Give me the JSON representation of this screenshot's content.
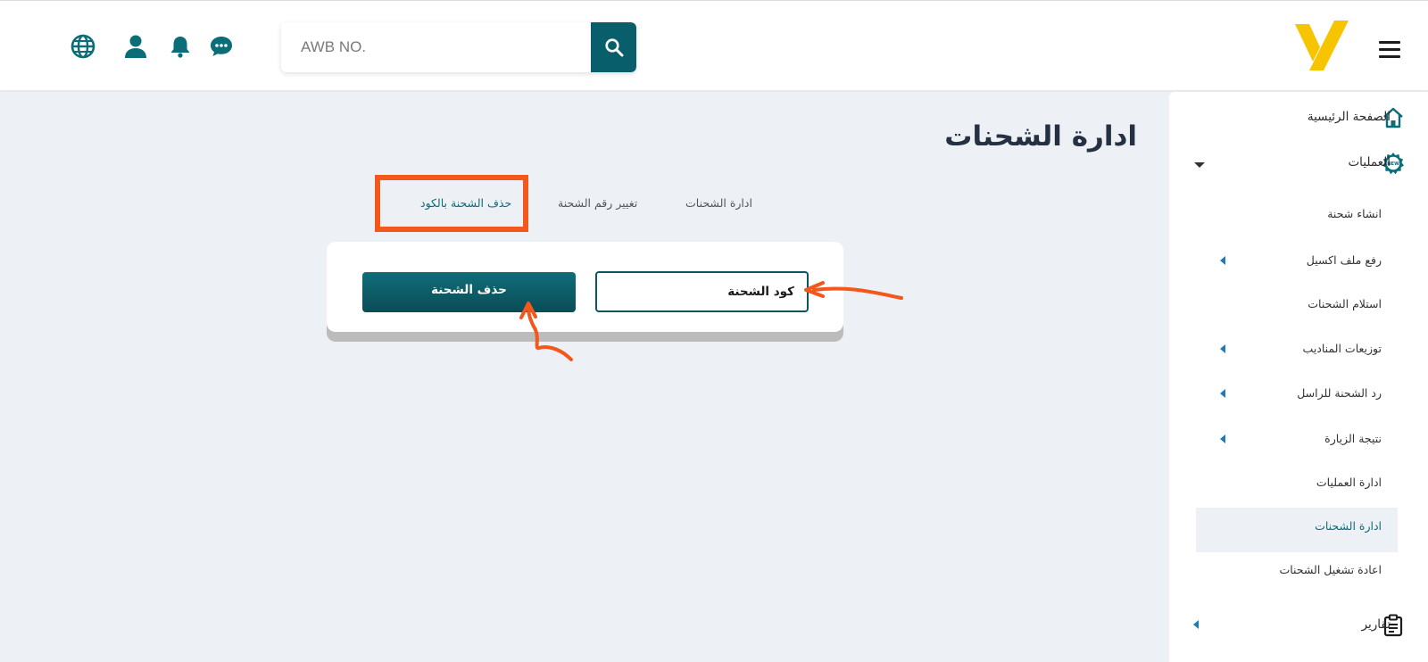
{
  "header": {
    "search": {
      "placeholder": "AWB NO.",
      "value": ""
    }
  },
  "sidebar": {
    "home_label": "الصفحة الرئيسية",
    "operations_label": "العمليات",
    "sub_items": [
      "انشاء شحنة",
      "رفع ملف اكسيل",
      "استلام الشحنات",
      "توزيعات المناديب",
      "رد الشحنة للراسل",
      "نتيجة الزيارة",
      "ادارة العمليات",
      "ادارة الشحنات",
      "اعادة تشغيل الشحنات"
    ],
    "active_item": "ادارة الشحنات",
    "reports_label": "تقارير",
    "new_badge": "NEW"
  },
  "main": {
    "title": "ادارة الشحنات",
    "tabs": [
      "ادارة الشحنات",
      "تغيير رقم الشحنة",
      "حذف الشحنة بالكود"
    ],
    "active_tab": "حذف الشحنة بالكود",
    "code_input_value": "كود الشحنة",
    "delete_button_label": "حذف الشحنة"
  },
  "colors": {
    "brand_teal": "#085f6b",
    "logo_yellow": "#f6c400",
    "highlight_orange": "#f2571b",
    "background": "#edf1f5"
  }
}
